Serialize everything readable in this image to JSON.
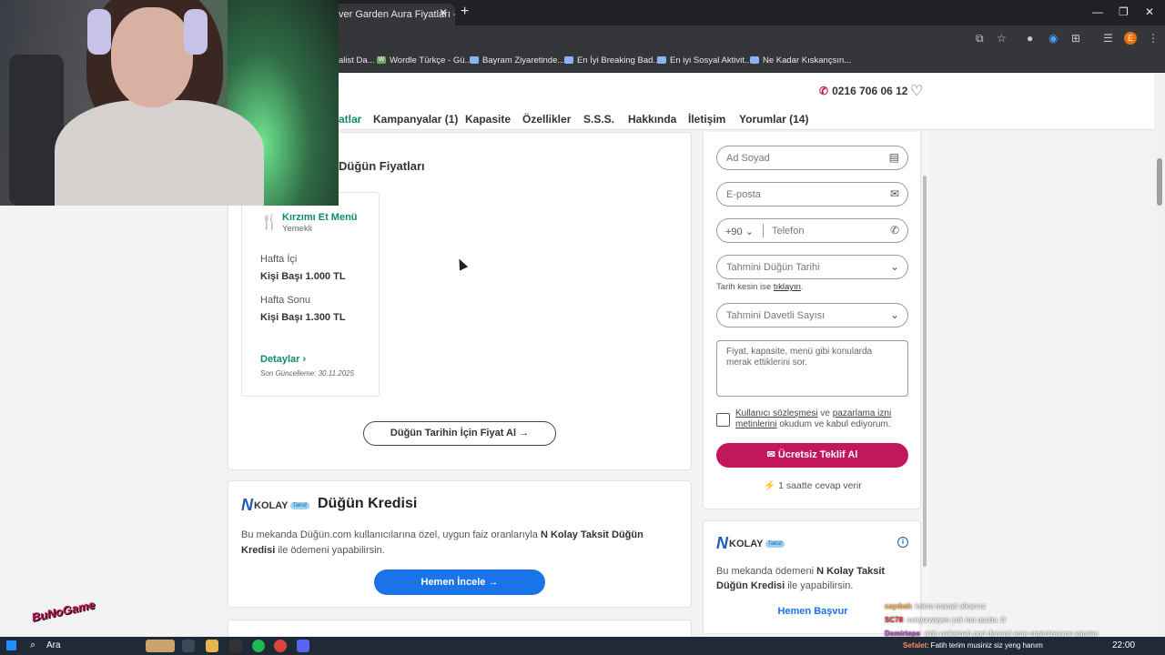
{
  "browser": {
    "tab_title": "ver Garden Aura Fiyatları - Kı",
    "tab_close": "✕",
    "tab_new": "+",
    "bookmarks": [
      {
        "label": "alist Da..."
      },
      {
        "label": "Wordle Türkçe - Gü..."
      },
      {
        "label": "Bayram Ziyaretinde..."
      },
      {
        "label": "En İyi Breaking Bad..."
      },
      {
        "label": "En iyi Sosyal Aktivit..."
      },
      {
        "label": "Ne Kadar Kıskançsın..."
      }
    ],
    "profile_initial": "E"
  },
  "header": {
    "phone": "0216 706 06 12",
    "heart_icon": "heart-icon"
  },
  "nav": {
    "items": [
      {
        "label": "atlar"
      },
      {
        "label": "Kampanyalar (1)"
      },
      {
        "label": "Kapasite"
      },
      {
        "label": "Özellikler"
      },
      {
        "label": "S.S.S."
      },
      {
        "label": "Hakkında"
      },
      {
        "label": "İletişim"
      },
      {
        "label": "Yorumlar (14)"
      }
    ]
  },
  "prices": {
    "title": "Düğün Fiyatları",
    "menu": {
      "name": "Kırzımı Et Menü",
      "type": "Yemekli",
      "weekday_label": "Hafta İçi",
      "weekday_price": "Kişi Başı 1.000 TL",
      "weekend_label": "Hafta Sonu",
      "weekend_price": "Kişi Başı 1.300 TL",
      "details": "Detaylar",
      "updated": "Son Güncelleme: 30.11.2025"
    },
    "cta": "Düğün Tarihin İçin Fiyat Al"
  },
  "credit": {
    "brand_n": "N",
    "brand_kolay": "KOLAY",
    "brand_taksit": "Taksit",
    "title": "Düğün Kredisi",
    "text_pre": "Bu mekanda Düğün.com kullanıcılarına özel, uygun faiz oranlarıyla ",
    "text_bold": "N Kolay Taksit Düğün Kredisi",
    "text_post": " ile ödemeni yapabilirsin.",
    "button": "Hemen İncele"
  },
  "form": {
    "name_placeholder": "Ad Soyad",
    "email_placeholder": "E-posta",
    "phone_prefix": "+90",
    "phone_placeholder": "Telefon",
    "date_placeholder": "Tahmini Düğün Tarihi",
    "hint_pre": "Tarih kesin ise ",
    "hint_link": "tıklayın",
    "hint_post": ".",
    "guests_placeholder": "Tahmini Davetli Sayısı",
    "message_placeholder": "Fiyat, kapasite, menü gibi konularda merak ettiklerini sor.",
    "agree_link1": "Kullanıcı sözleşmesi",
    "agree_mid": " ve ",
    "agree_link2": "pazarlama izni metinlerini",
    "agree_post": " okudum ve kabul ediyorum.",
    "submit": "Ücretsiz Teklif Al",
    "reply": "1 saatte cevap verir"
  },
  "side_credit": {
    "text_pre": "Bu mekanda ödemeni ",
    "text_bold": "N Kolay Taksit Düğün Kredisi",
    "text_post": " ile yapabilirsin.",
    "link": "Hemen Başvur"
  },
  "overlay": {
    "logo": "BuNoGame",
    "chat": [
      {
        "user": "cayıbalı",
        "msg": ": kebre manati alkarırız"
      },
      {
        "user": "SC78",
        "msg": ": sariyorwayen yok ma usuba :0"
      },
      {
        "user": "Demirtepe",
        "msg": ": aldu wakamah pori deneryi ama organizasyon yapıları"
      }
    ],
    "ticker_user": "Sefalet",
    "ticker_msg": ": Fatih terim musiniz siz yeng hanım"
  },
  "taskbar": {
    "search": "Ara",
    "clock": "22:00"
  },
  "colors": {
    "accent_green": "#0e8a6e",
    "accent_pink": "#c2185b",
    "accent_blue": "#1a73e8"
  }
}
